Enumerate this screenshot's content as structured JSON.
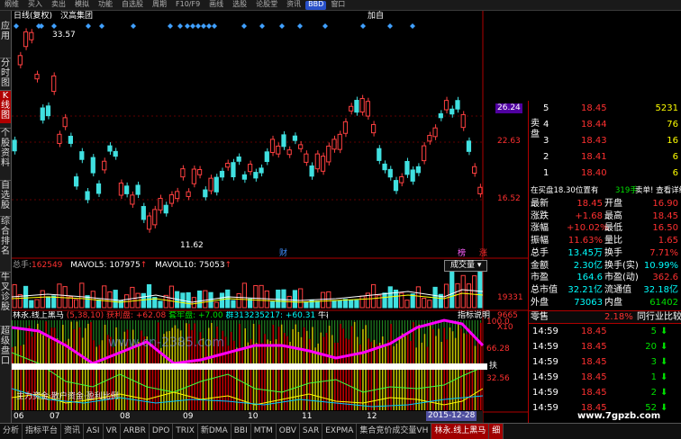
{
  "menu": [
    "纲维",
    "买入",
    "卖出",
    "模拟",
    "功能",
    "自选股",
    "周期",
    "F10/F9",
    "画线",
    "选股",
    "论股堂",
    "资讯",
    "BBD",
    "窗口"
  ],
  "sidebar": [
    "应用",
    "分时图",
    "K线图",
    "个股资料",
    "自选股",
    "综合排名",
    "牛叉诊股",
    "超级盘口"
  ],
  "chart_header": {
    "left": "日线(复权)",
    "name": "汉高集团",
    "right": "加自"
  },
  "price_labels": {
    "high": "33.57",
    "low": "11.62",
    "p1": "26.24",
    "p2": "22.63",
    "p3": "16.52"
  },
  "markers": {
    "cai": "财",
    "bang": "榜",
    "zhang": "涨"
  },
  "volume_line": {
    "total_label": "总手:",
    "total": "162549",
    "mavol5": "MAVOL5: 107975",
    "mavol10": "MAVOL10: 75053",
    "selector": "成交量",
    "v1": "19331",
    "v2": "9665",
    "unit": "X10"
  },
  "indicator_line": {
    "name": "林永.线上黑马",
    "params": "(5,38,10)",
    "profit": "获利盘: +62.08",
    "arb": "套牢盘: +7.00",
    "group": "群313235217: +60.31",
    "bull": "牛群3132",
    "help": "指标说明",
    "s1": "100.0",
    "s2": "66.28",
    "s3": "32.56",
    "tag": "扶",
    "overlay": "主力资金·散户资金·盈利比例",
    "watermark": "www.cn-2385.com"
  },
  "x_axis": [
    "06",
    "07",
    "08",
    "09",
    "10",
    "11",
    "12"
  ],
  "date_badge": "2015-12-28",
  "bottom_tabs": [
    "分析",
    "指标平台",
    "资讯",
    "ASI",
    "VR",
    "ARBR",
    "DPO",
    "TRIX",
    "新DMA",
    "BBI",
    "MTM",
    "OBV",
    "SAR",
    "EXPMA",
    "集合竞价成交量VH",
    "林永.线上黑马",
    "细"
  ],
  "right_panel": {
    "sell_label": "卖盘",
    "buy_label": "买盘",
    "sells": [
      {
        "n": "5",
        "p": "18.45",
        "v": "5231"
      },
      {
        "n": "4",
        "p": "18.44",
        "v": "76"
      },
      {
        "n": "3",
        "p": "18.43",
        "v": "16"
      },
      {
        "n": "2",
        "p": "18.41",
        "v": "6"
      },
      {
        "n": "1",
        "p": "18.40",
        "v": "6"
      }
    ],
    "info_bar": {
      "a": "在买盘18.30位置有",
      "b": "319手",
      "c": "卖单! 查看详细"
    },
    "stats": [
      {
        "k1": "最新",
        "v1": "18.45",
        "k2": "开盘",
        "v2": "16.90"
      },
      {
        "k1": "涨跌",
        "v1": "+1.68",
        "k2": "最高",
        "v2": "18.45"
      },
      {
        "k1": "涨幅",
        "v1": "+10.02%",
        "k2": "最低",
        "v2": "16.50"
      },
      {
        "k1": "振幅",
        "v1": "11.63%",
        "k2": "量比",
        "v2": "1.65"
      },
      {
        "k1": "总手",
        "v1": "13.45万",
        "k2": "换手",
        "v2": "7.71%"
      },
      {
        "k1": "金额",
        "v1": "2.30亿",
        "k2": "换手(实)",
        "v2": "10.99%"
      },
      {
        "k1": "市盈",
        "v1": "164.6",
        "k2": "市盈(动)",
        "v2": "362.6"
      },
      {
        "k1": "总市值",
        "v1": "32.21亿",
        "k2": "流通值",
        "v2": "32.18亿"
      },
      {
        "k1": "外盘",
        "v1": "73063",
        "k2": "内盘",
        "v2": "61402"
      }
    ],
    "tick_header": {
      "a": "零售",
      "b": "2.18%",
      "c": "同行业比较"
    },
    "ticks": [
      {
        "t": "14:59",
        "p": "18.45",
        "v": "5"
      },
      {
        "t": "14:59",
        "p": "18.45",
        "v": "20"
      },
      {
        "t": "14:59",
        "p": "18.45",
        "v": "3"
      },
      {
        "t": "14:59",
        "p": "18.45",
        "v": "1"
      },
      {
        "t": "14:59",
        "p": "18.45",
        "v": "2"
      },
      {
        "t": "14:59",
        "p": "18.45",
        "v": "52"
      }
    ]
  },
  "watermark_url": "www.7gpzb.com"
}
